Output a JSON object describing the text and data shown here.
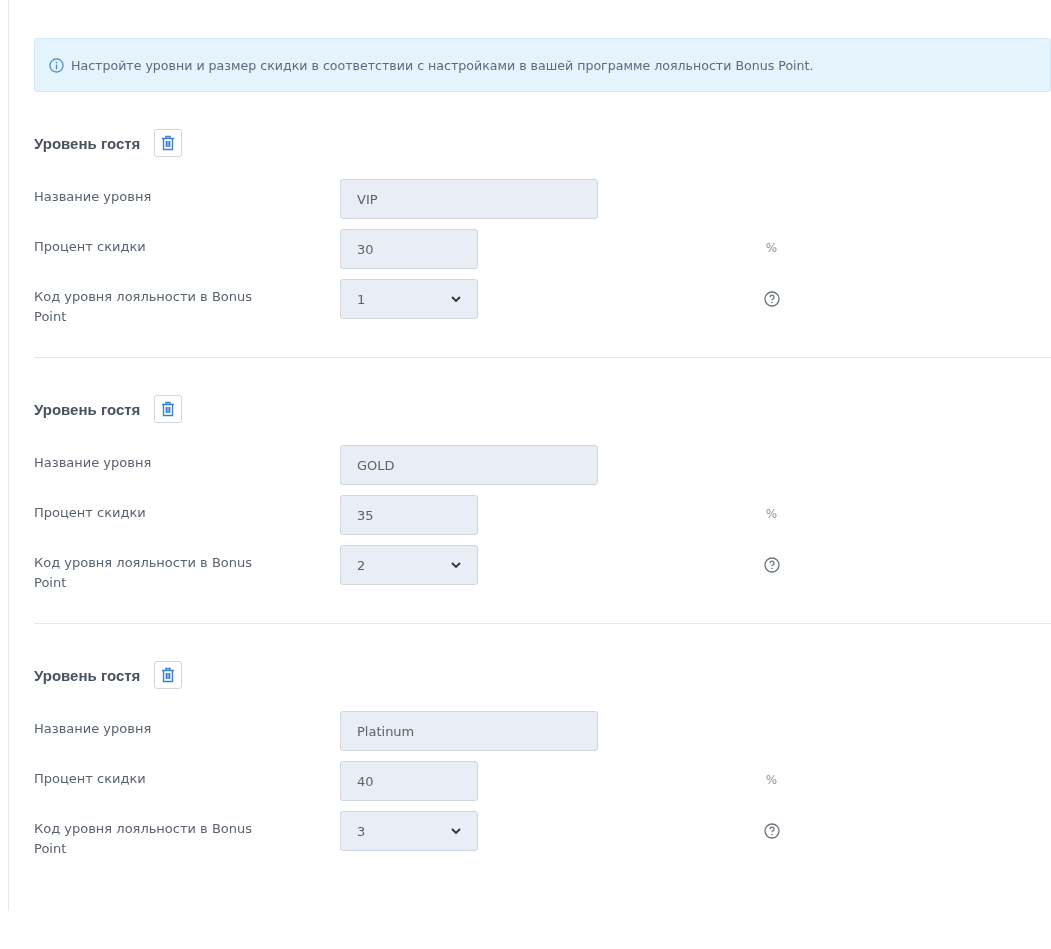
{
  "notice": "Настройте уровни и размер скидки в соответствии с настройками в вашей программе лояльности Bonus Point.",
  "levels": [
    {
      "title": "Уровень гостя",
      "name_label": "Название уровня",
      "name_value": "VIP",
      "percent_label": "Процент скидки",
      "percent_value": "30",
      "percent_unit": "%",
      "code_label": "Код уровня лояльности в Bonus Point",
      "code_value": "1"
    },
    {
      "title": "Уровень гостя",
      "name_label": "Название уровня",
      "name_value": "GOLD",
      "percent_label": "Процент скидки",
      "percent_value": "35",
      "percent_unit": "%",
      "code_label": "Код уровня лояльности в Bonus Point",
      "code_value": "2"
    },
    {
      "title": "Уровень гостя",
      "name_label": "Название уровня",
      "name_value": "Platinum",
      "percent_label": "Процент скидки",
      "percent_value": "40",
      "percent_unit": "%",
      "code_label": "Код уровня лояльности в Bonus Point",
      "code_value": "3"
    }
  ]
}
